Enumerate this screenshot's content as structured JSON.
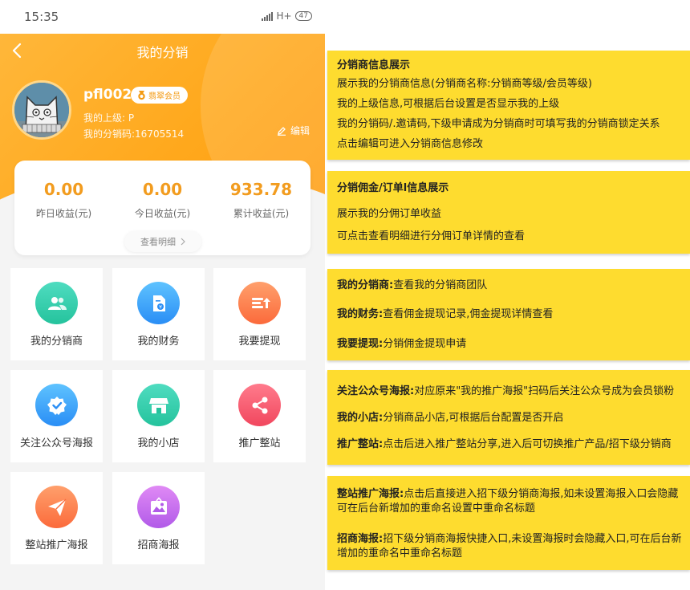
{
  "status_bar": {
    "time": "15:35",
    "network": "H+",
    "battery": "47"
  },
  "header": {
    "title": "我的分销"
  },
  "profile": {
    "username": "pfl002",
    "badge": "翡翠会员",
    "parent": "我的上级: P",
    "code": "我的分销码:16705514",
    "edit_label": "编辑"
  },
  "stats": {
    "items": [
      {
        "value": "0.00",
        "label": "昨日收益(元)"
      },
      {
        "value": "0.00",
        "label": "今日收益(元)"
      },
      {
        "value": "933.78",
        "label": "累计收益(元)"
      }
    ],
    "detail_label": "查看明细"
  },
  "menu": [
    {
      "label": "我的分销商",
      "icon": "team-icon",
      "color_from": "#4fdcc0",
      "color_to": "#25c39d"
    },
    {
      "label": "我的财务",
      "icon": "finance-doc-icon",
      "color_from": "#5fc3ff",
      "color_to": "#2a8ef5"
    },
    {
      "label": "我要提现",
      "icon": "withdraw-icon",
      "color_from": "#ffa06c",
      "color_to": "#fb6a3b"
    },
    {
      "label": "关注公众号海报",
      "icon": "verified-badge-icon",
      "color_from": "#5fc3ff",
      "color_to": "#2a8ef5"
    },
    {
      "label": "我的小店",
      "icon": "shop-icon",
      "color_from": "#4fdcc0",
      "color_to": "#25c39d"
    },
    {
      "label": "推广整站",
      "icon": "share-icon",
      "color_from": "#ff7b8c",
      "color_to": "#f1475e"
    },
    {
      "label": "整站推广海报",
      "icon": "paper-plane-icon",
      "color_from": "#ffa06c",
      "color_to": "#fb6a3b"
    },
    {
      "label": "招商海报",
      "icon": "image-icon",
      "color_from": "#e08af5",
      "color_to": "#b15ae8"
    }
  ],
  "annotations": {
    "box1": {
      "title": "分销商信息展示",
      "lines": [
        "展示我的分销商信息(分销商名称:分销商等级/会员等级)",
        "我的上级信息,可根据后台设置是否显示我的上级",
        "我的分销码/.邀请码,下级申请成为分销商时可填写我的分销商锁定关系",
        "点击编辑可进入分销商信息修改"
      ]
    },
    "box2": {
      "title": "分销佣金/订单l信息展示",
      "lines": [
        "展示我的分佣订单收益",
        "可点击查看明细进行分佣订单详情的查看"
      ]
    },
    "box3": [
      {
        "head": "我的分销商:",
        "text": "查看我的分销商团队"
      },
      {
        "head": "我的财务:",
        "text": "查看佣金提现记录,佣金提现详情查看"
      },
      {
        "head": "我要提现:",
        "text": "分销佣金提现申请"
      }
    ],
    "box4": [
      {
        "head": "关注公众号海报:",
        "text": "对应原来\"我的推广海报\"扫码后关注公众号成为会员锁粉"
      },
      {
        "head": "我的小店:",
        "text": "分销商品小店,可根据后台配置是否开启"
      },
      {
        "head": "推广整站:",
        "text": "点击后进入推广整站分享,进入后可切换推广产品/招下级分销商"
      }
    ],
    "box5": [
      {
        "head": "整站推广海报:",
        "text": "点击后直接进入招下级分销商海报,如未设置海报入口会隐藏可在后台新增加的重命名设置中重命名标题"
      },
      {
        "head": "招商海报:",
        "text": "招下级分销商海报快捷入口,未设置海报时会隐藏入口,可在后台新增加的重命名中重命名标题"
      }
    ]
  }
}
